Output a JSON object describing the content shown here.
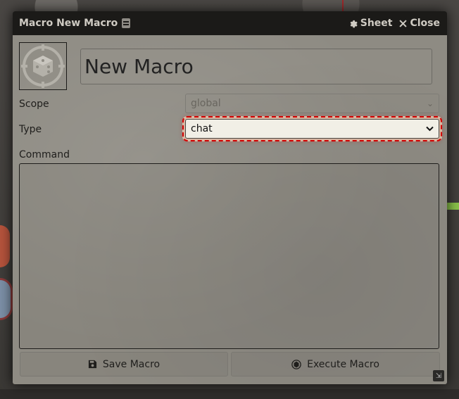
{
  "window": {
    "title": "Macro New Macro",
    "sheet_label": "Sheet",
    "close_label": "Close"
  },
  "form": {
    "name_value": "New Macro",
    "scope_label": "Scope",
    "scope_value": "global",
    "type_label": "Type",
    "type_value": "chat",
    "command_label": "Command",
    "command_value": ""
  },
  "buttons": {
    "save_label": "Save Macro",
    "execute_label": "Execute Macro"
  },
  "colors": {
    "header_bg": "#1b1a18",
    "window_bg": "#8e8b83",
    "highlight": "#d40000"
  },
  "icons": {
    "title": "document-icon",
    "sheet": "gear-icon",
    "close": "x-icon",
    "macro_image": "dice-icon",
    "save": "save-icon",
    "execute": "dice-icon"
  }
}
